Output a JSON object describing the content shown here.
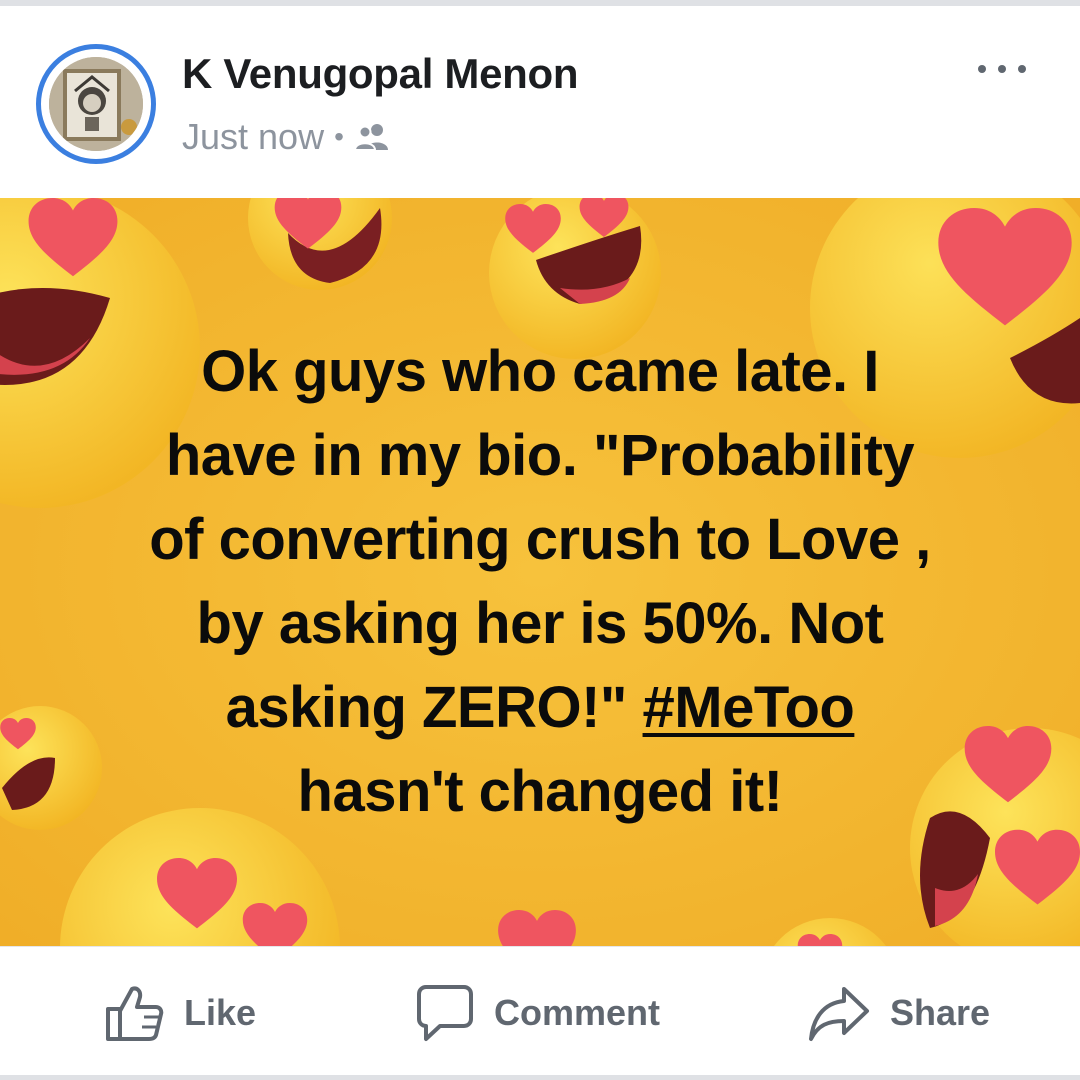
{
  "post": {
    "author": "K Venugopal Menon",
    "timestamp": "Just now",
    "separator": "•",
    "audience_icon": "friends-icon",
    "more_icon": "more-options-icon",
    "background_theme": "heart-eyes emoji",
    "text_lines": [
      "Ok guys who came late. I",
      "have in my bio. \"Probability",
      "of converting crush to Love ,",
      "by asking her is 50%. Not"
    ],
    "text_line5_prefix": "asking ZERO!\" ",
    "hashtag": "#MeToo",
    "text_line6": "hasn't changed it!"
  },
  "actions": {
    "like": "Like",
    "comment": "Comment",
    "share": "Share"
  },
  "colors": {
    "accent": "#3b7fe0",
    "post_bg": "#f5b731",
    "emoji_yellow": "#f8c82c",
    "heart": "#f0545e",
    "action_grey": "#606770"
  }
}
